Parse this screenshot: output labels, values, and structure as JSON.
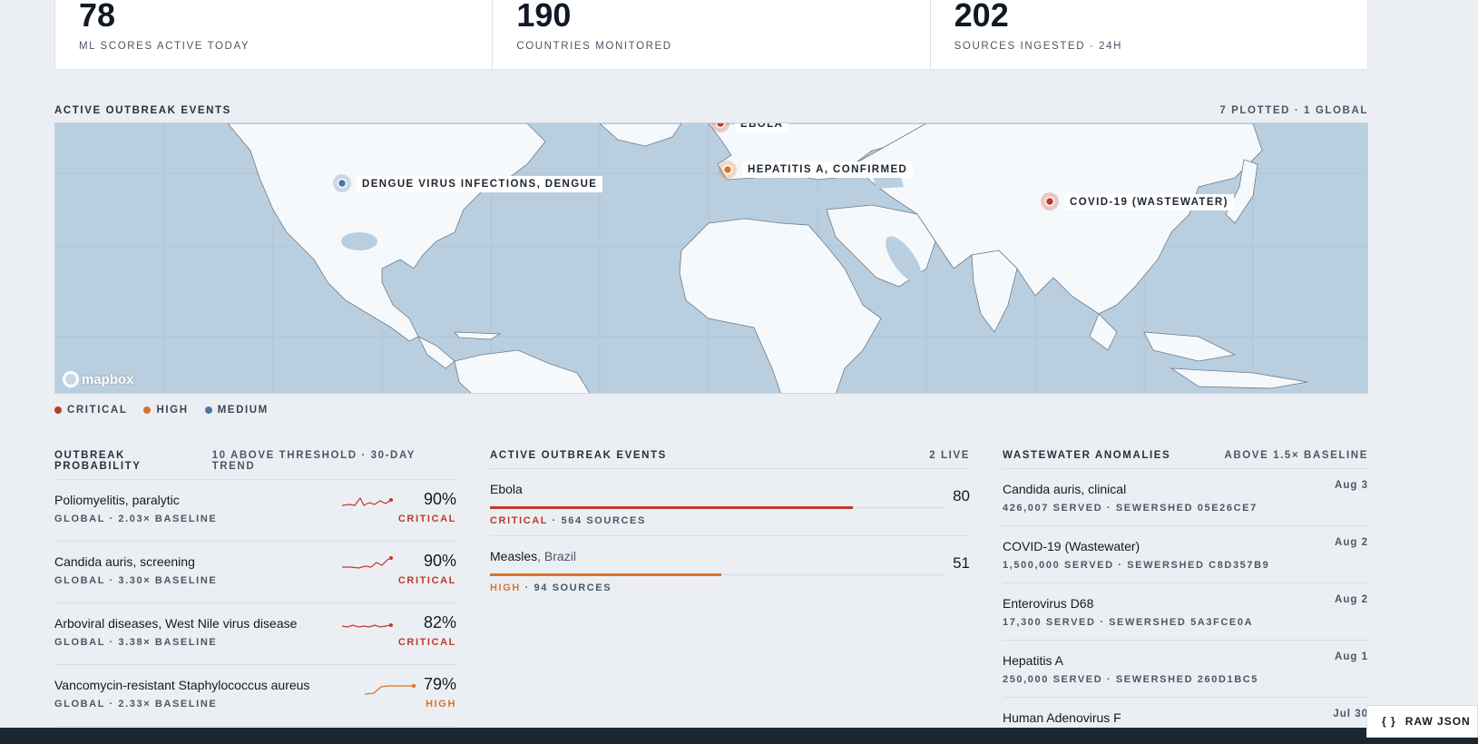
{
  "stats": [
    {
      "value": "78",
      "label": "ML SCORES ACTIVE TODAY"
    },
    {
      "value": "190",
      "label": "COUNTRIES MONITORED"
    },
    {
      "value": "202",
      "label": "SOURCES INGESTED · 24H"
    }
  ],
  "map_section": {
    "title": "ACTIVE OUTBREAK EVENTS",
    "summary": "7 PLOTTED · 1 GLOBAL",
    "attribution": "mapbox"
  },
  "map_pins": [
    {
      "label": "DENGUE VIRUS INFECTIONS, DENGUE",
      "severity": "medium"
    },
    {
      "label": "EBOLA",
      "severity": "critical"
    },
    {
      "label": "HEPATITIS A, CONFIRMED",
      "severity": "high"
    },
    {
      "label": "COVID-19 (WASTEWATER)",
      "severity": "critical"
    }
  ],
  "legend": {
    "critical": "CRITICAL",
    "high": "HIGH",
    "medium": "MEDIUM"
  },
  "colors": {
    "critical": "#c0392b",
    "high": "#d9742b",
    "medium": "#4f76a3"
  },
  "probability": {
    "title": "OUTBREAK PROBABILITY",
    "summary": "10 ABOVE THRESHOLD · 30-DAY TREND",
    "rows": [
      {
        "name": "Poliomyelitis, paralytic",
        "sub": "GLOBAL · 2.03× BASELINE",
        "pct": "90%",
        "level": "CRITICAL"
      },
      {
        "name": "Candida auris, screening",
        "sub": "GLOBAL · 3.30× BASELINE",
        "pct": "90%",
        "level": "CRITICAL"
      },
      {
        "name": "Arboviral diseases, West Nile virus disease",
        "sub": "GLOBAL · 3.38× BASELINE",
        "pct": "82%",
        "level": "CRITICAL"
      },
      {
        "name": "Vancomycin-resistant Staphylococcus aureus",
        "sub": "GLOBAL · 2.33× BASELINE",
        "pct": "79%",
        "level": "HIGH"
      }
    ]
  },
  "events": {
    "title": "ACTIVE OUTBREAK EVENTS",
    "summary": "2 LIVE",
    "rows": [
      {
        "name": "Ebola",
        "location": "",
        "score": "80",
        "score_value": 80,
        "level": "CRITICAL",
        "sources": "· 564 SOURCES"
      },
      {
        "name": "Measles",
        "location": ", Brazil",
        "score": "51",
        "score_value": 51,
        "level": "HIGH",
        "sources": "· 94 SOURCES"
      }
    ]
  },
  "wastewater": {
    "title": "WASTEWATER ANOMALIES",
    "summary": "ABOVE 1.5× BASELINE",
    "rows": [
      {
        "name": "Candida auris, clinical",
        "sub": "426,007 SERVED · SEWERSHED 05E26CE7",
        "date": "Aug 3"
      },
      {
        "name": "COVID-19 (Wastewater)",
        "sub": "1,500,000 SERVED · SEWERSHED C8D357B9",
        "date": "Aug 2"
      },
      {
        "name": "Enterovirus D68",
        "sub": "17,300 SERVED · SEWERSHED 5A3FCE0A",
        "date": "Aug 2"
      },
      {
        "name": "Hepatitis A",
        "sub": "250,000 SERVED · SEWERSHED 260D1BC5",
        "date": "Aug 1"
      },
      {
        "name": "Human Adenovirus F",
        "sub": "",
        "date": "Jul 30"
      }
    ]
  },
  "raw_json": {
    "icon": "{ }",
    "label": "RAW JSON"
  }
}
